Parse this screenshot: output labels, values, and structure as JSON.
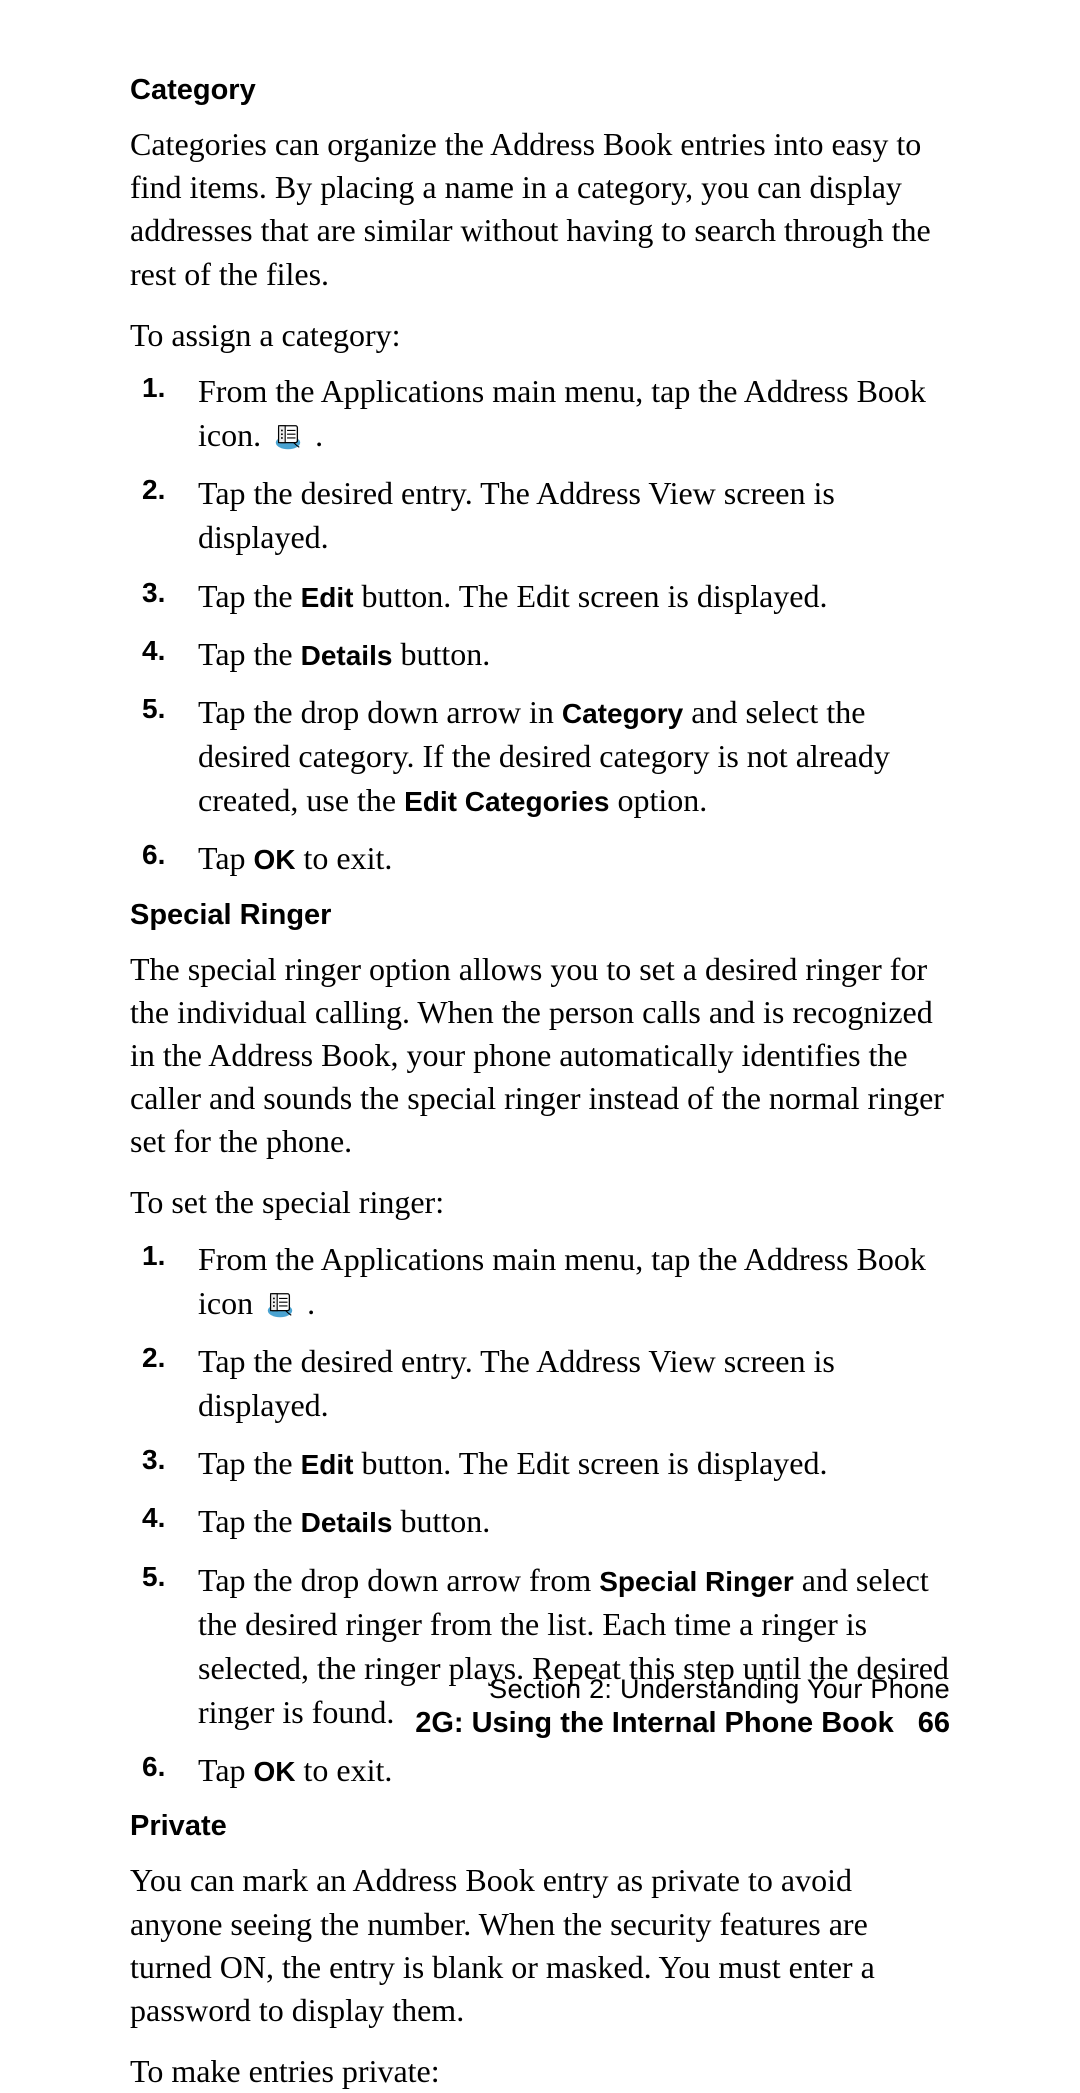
{
  "icons": {
    "addressbook": "addressbook-icon"
  },
  "sections": [
    {
      "heading": "Category",
      "para": "Categories can organize the Address Book entries into easy to find items. By placing a name in a category, you can display addresses that are similar without having to search through the rest of the files.",
      "lead": "To assign a category:",
      "steps": [
        {
          "n": "1.",
          "runs": [
            {
              "t": "From the Applications main menu, tap the Address Book icon. "
            },
            {
              "icon": "addressbook"
            },
            {
              "t": " ."
            }
          ]
        },
        {
          "n": "2.",
          "runs": [
            {
              "t": "Tap the desired entry. The Address View screen is displayed."
            }
          ]
        },
        {
          "n": "3.",
          "runs": [
            {
              "t": "Tap the "
            },
            {
              "b": "Edit"
            },
            {
              "t": " button. The Edit screen is displayed."
            }
          ]
        },
        {
          "n": "4.",
          "runs": [
            {
              "t": "Tap the "
            },
            {
              "b": "Details"
            },
            {
              "t": " button."
            }
          ]
        },
        {
          "n": "5.",
          "runs": [
            {
              "t": "Tap the drop down arrow in "
            },
            {
              "b": "Category"
            },
            {
              "t": " and select the desired category. If the desired category is not already created, use the "
            },
            {
              "b": "Edit Categories"
            },
            {
              "t": " option."
            }
          ]
        },
        {
          "n": "6.",
          "runs": [
            {
              "t": "Tap "
            },
            {
              "b": "OK"
            },
            {
              "t": " to exit."
            }
          ]
        }
      ]
    },
    {
      "heading": "Special Ringer",
      "para": "The special ringer option allows you to set a desired ringer for the individual calling. When the person calls and is recognized in the Address Book, your phone automatically identifies the caller and sounds the special ringer instead of the normal ringer set for the phone.",
      "lead": "To set the special ringer:",
      "steps": [
        {
          "n": "1.",
          "runs": [
            {
              "t": "From the Applications main menu, tap the Address Book icon "
            },
            {
              "icon": "addressbook"
            },
            {
              "t": " ."
            }
          ]
        },
        {
          "n": "2.",
          "runs": [
            {
              "t": "Tap the desired entry. The Address View screen is displayed."
            }
          ]
        },
        {
          "n": "3.",
          "runs": [
            {
              "t": "Tap the "
            },
            {
              "b": "Edit"
            },
            {
              "t": " button. The Edit screen is displayed."
            }
          ]
        },
        {
          "n": "4.",
          "runs": [
            {
              "t": "Tap the "
            },
            {
              "b": "Details"
            },
            {
              "t": " button."
            }
          ]
        },
        {
          "n": "5.",
          "runs": [
            {
              "t": "Tap the drop down arrow from "
            },
            {
              "b": "Special Ringer"
            },
            {
              "t": " and select the desired ringer from the list. Each time a ringer is selected, the ringer plays. Repeat this step until the desired ringer is found."
            }
          ]
        },
        {
          "n": "6.",
          "runs": [
            {
              "t": "Tap "
            },
            {
              "b": "OK"
            },
            {
              "t": " to exit."
            }
          ]
        }
      ]
    },
    {
      "heading": "Private",
      "para": "You can mark an Address Book entry as private to avoid anyone seeing the number. When the security features are turned ON, the entry is blank or masked. You must enter a password to display them.",
      "lead": "To make entries private:",
      "steps": []
    }
  ],
  "footer": {
    "line1": "Section 2: Understanding Your Phone",
    "line2": "2G: Using the Internal Phone Book",
    "page": "66"
  }
}
